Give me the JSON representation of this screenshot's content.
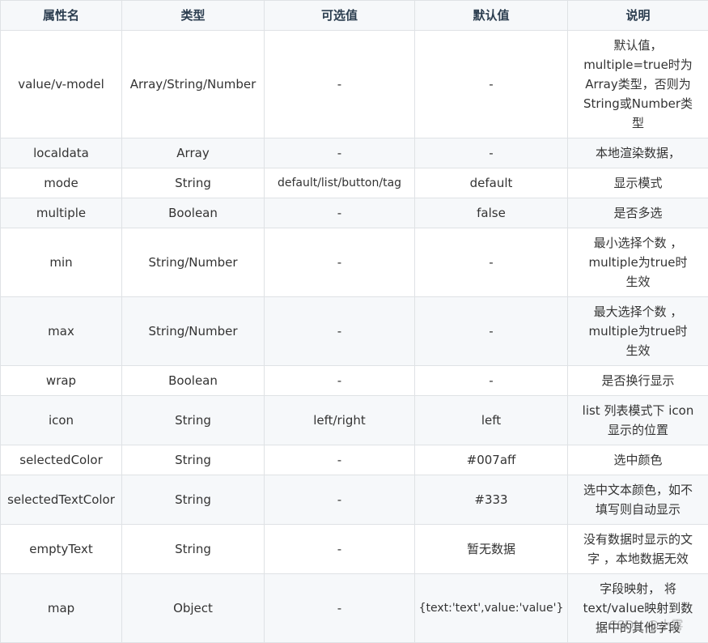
{
  "table": {
    "headers": [
      "属性名",
      "类型",
      "可选值",
      "默认值",
      "说明"
    ],
    "rows": [
      {
        "name": "value/v-model",
        "type": "Array/String/Number",
        "options": "-",
        "default": "-",
        "desc": "默认值，multiple=true时为Array类型，否则为String或Number类型"
      },
      {
        "name": "localdata",
        "type": "Array",
        "options": "-",
        "default": "-",
        "desc": "本地渲染数据，"
      },
      {
        "name": "mode",
        "type": "String",
        "options": "default/list/button/tag",
        "default": "default",
        "desc": "显示模式"
      },
      {
        "name": "multiple",
        "type": "Boolean",
        "options": "-",
        "default": "false",
        "desc": "是否多选"
      },
      {
        "name": "min",
        "type": "String/Number",
        "options": "-",
        "default": "-",
        "desc": "最小选择个数 ，multiple为true时生效"
      },
      {
        "name": "max",
        "type": "String/Number",
        "options": "-",
        "default": "-",
        "desc": "最大选择个数 ，multiple为true时生效"
      },
      {
        "name": "wrap",
        "type": "Boolean",
        "options": "-",
        "default": "-",
        "desc": "是否换行显示"
      },
      {
        "name": "icon",
        "type": "String",
        "options": "left/right",
        "default": "left",
        "desc": "list 列表模式下 icon 显示的位置"
      },
      {
        "name": "selectedColor",
        "type": "String",
        "options": "-",
        "default": "#007aff",
        "desc": "选中颜色"
      },
      {
        "name": "selectedTextColor",
        "type": "String",
        "options": "-",
        "default": "#333",
        "desc": "选中文本颜色，如不填写则自动显示"
      },
      {
        "name": "emptyText",
        "type": "String",
        "options": "-",
        "default": "暂无数据",
        "desc": "没有数据时显示的文字 ，本地数据无效"
      },
      {
        "name": "map",
        "type": "Object",
        "options": "-",
        "default": "{text:'text',value:'value'}",
        "desc": "字段映射， 将text/value映射到数据中的其他字段"
      }
    ]
  },
  "watermark": "CSDN @小雾"
}
